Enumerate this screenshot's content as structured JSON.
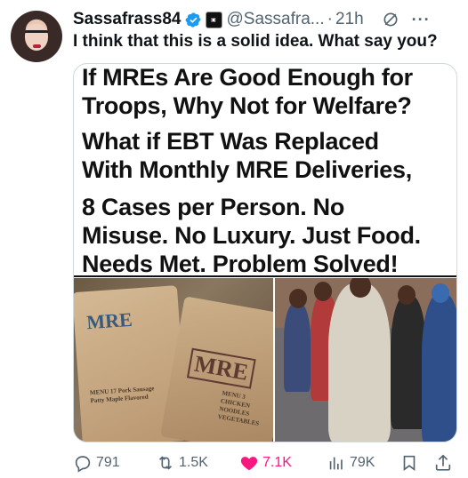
{
  "author": {
    "display_name": "Sassafrass84",
    "handle": "@Sassafra...",
    "time": "21h"
  },
  "tweet": {
    "text": "I think that this is a solid idea. What say you?"
  },
  "media": {
    "meme_lines": [
      "If MREs Are Good Enough for",
      "Troops, Why Not for Welfare?",
      "What if EBT Was Replaced",
      "With Monthly MRE Deliveries,",
      "8 Cases per Person. No",
      "Misuse. No Luxury. Just Food.",
      "Needs Met. Problem Solved!"
    ],
    "pouch_a_title": "MRE",
    "pouch_a_menu": "MENU 17 Pork Sausage Patty Maple Flavored",
    "pouch_b_title": "MRE",
    "pouch_b_menu": "MENU 3 CHICKEN NOODLES VEGETABLES"
  },
  "actions": {
    "reply_count": "791",
    "repost_count": "1.5K",
    "like_count": "7.1K",
    "views_count": "79K"
  },
  "icons": {
    "verified": "verified-badge-icon",
    "grok": "grok-icon",
    "more": "more-icon",
    "reply": "reply-icon",
    "repost": "repost-icon",
    "like": "heart-icon",
    "views": "views-icon",
    "bookmark": "bookmark-icon",
    "share": "share-icon"
  },
  "colors": {
    "verified": "#1d9bf0",
    "like": "#f91880",
    "secondary_text": "#536471"
  }
}
